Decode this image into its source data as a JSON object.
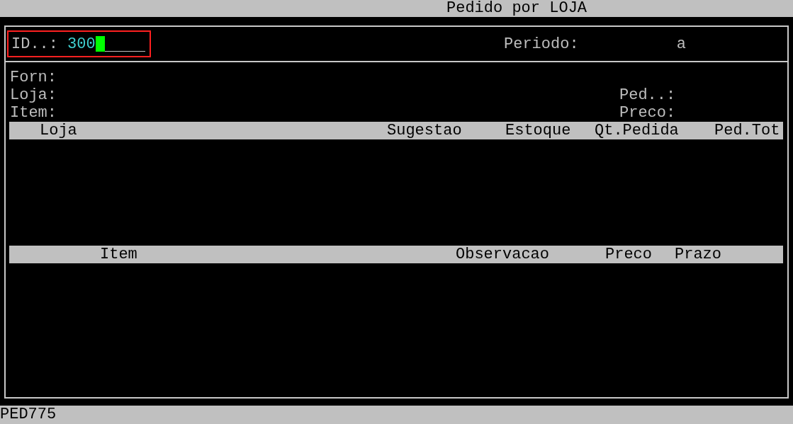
{
  "window": {
    "title": "Pedido por LOJA"
  },
  "id_field": {
    "label": "ID..:",
    "value": "300",
    "focused": true
  },
  "period": {
    "label": "Periodo:",
    "separator": "a"
  },
  "info_rows": [
    {
      "left": "Forn:"
    },
    {
      "left": "Loja:",
      "right": "Ped..:"
    },
    {
      "left": "Item:",
      "right": "Preco:"
    }
  ],
  "orders_table": {
    "columns": [
      "Loja",
      "Sugestao",
      "Estoque",
      "Qt.Pedida",
      "Ped.Tot"
    ]
  },
  "items_table": {
    "columns": [
      "Item",
      "Observacao",
      "Preco",
      "Prazo"
    ]
  },
  "status_bar": {
    "program": "PED775"
  }
}
